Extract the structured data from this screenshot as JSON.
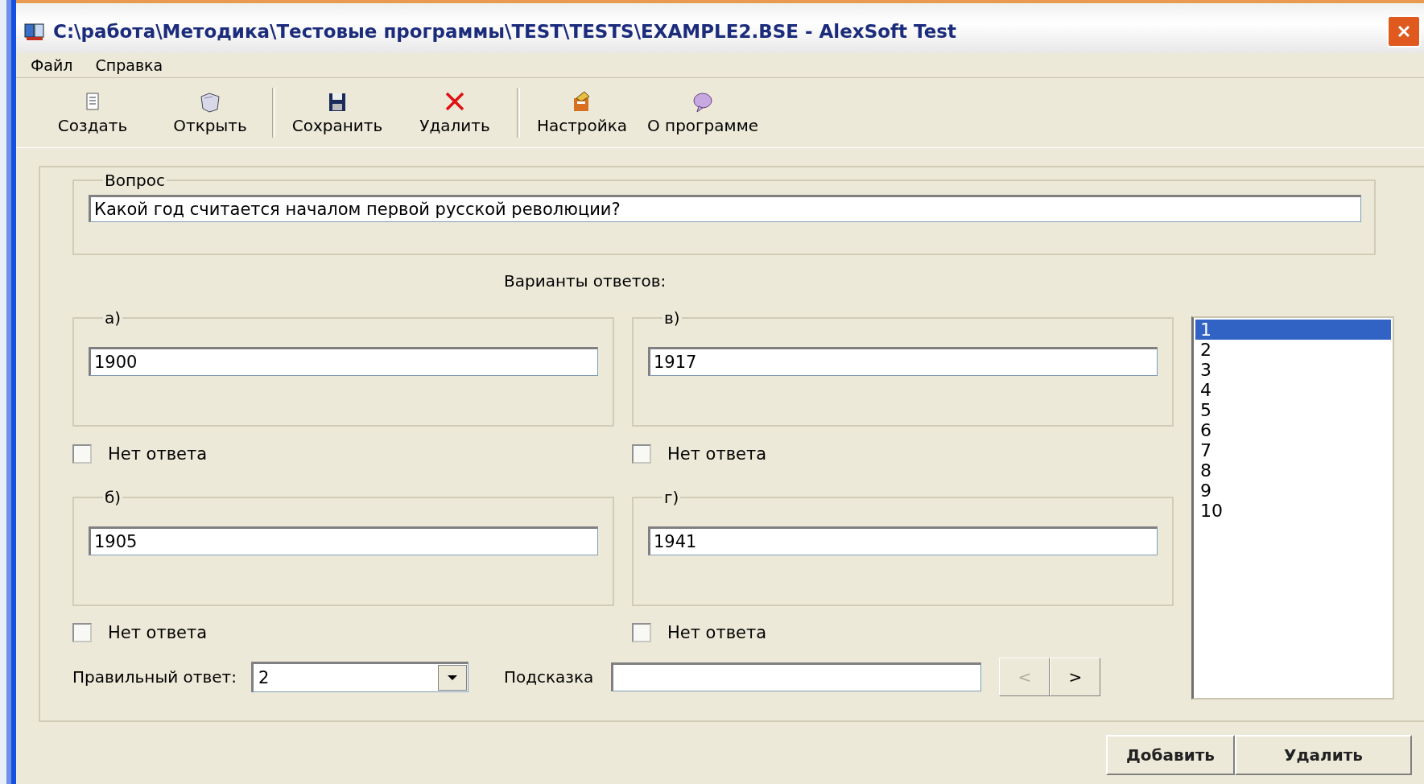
{
  "window": {
    "title": "C:\\работа\\Методика\\Тестовые программы\\TEST\\TESTS\\EXAMPLE2.BSE - AlexSoft Test"
  },
  "menu": [
    "Файл",
    "Справка"
  ],
  "toolbar": [
    [
      {
        "label": "Создать",
        "kind": "new"
      },
      {
        "label": "Открыть",
        "kind": "open"
      }
    ],
    [
      {
        "label": "Сохранить",
        "kind": "save"
      },
      {
        "label": "Удалить",
        "kind": "delete"
      }
    ],
    [
      {
        "label": "Настройка",
        "kind": "settings"
      },
      {
        "label": "О программе",
        "kind": "about"
      }
    ]
  ],
  "question": {
    "legend": "Вопрос",
    "value": "Какой год считается началом первой русской революции?"
  },
  "answers_heading": "Варианты ответов:",
  "answers": [
    {
      "legend": "а)",
      "value": "1900",
      "no_answer": {
        "label": "Нет ответа",
        "checked": false
      }
    },
    {
      "legend": "в)",
      "value": "1917",
      "no_answer": {
        "label": "Нет ответа",
        "checked": false
      }
    },
    {
      "legend": "б)",
      "value": "1905",
      "no_answer": {
        "label": "Нет ответа",
        "checked": false
      }
    },
    {
      "legend": "г)",
      "value": "1941",
      "no_answer": {
        "label": "Нет ответа",
        "checked": false
      }
    }
  ],
  "correct_answer": {
    "label": "Правильный ответ:",
    "value": "2"
  },
  "hint": {
    "label": "Подсказка"
  },
  "nav_buttons": [
    {
      "label": "<",
      "disabled": true
    },
    {
      "label": ">",
      "disabled": false
    }
  ],
  "question_list": [
    {
      "label": "1",
      "selected": true
    },
    {
      "label": "2",
      "selected": false
    },
    {
      "label": "3",
      "selected": false
    },
    {
      "label": "4",
      "selected": false
    },
    {
      "label": "5",
      "selected": false
    },
    {
      "label": "6",
      "selected": false
    },
    {
      "label": "7",
      "selected": false
    },
    {
      "label": "8",
      "selected": false
    },
    {
      "label": "9",
      "selected": false
    },
    {
      "label": "10",
      "selected": false
    }
  ],
  "buttons": [
    "Добавить",
    "Удалить"
  ]
}
